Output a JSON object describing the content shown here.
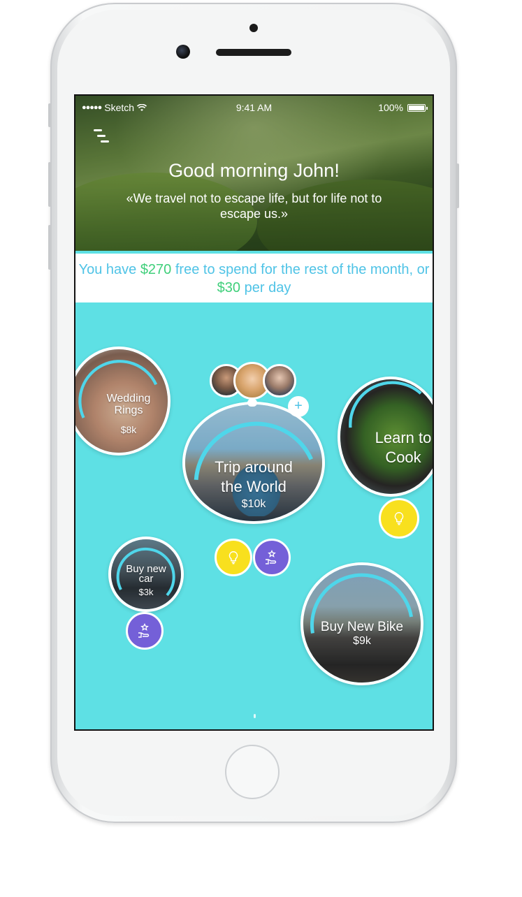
{
  "status_bar": {
    "carrier": "Sketch",
    "time": "9:41 AM",
    "battery": "100%"
  },
  "header": {
    "menu_icon": "menu-icon",
    "greeting": "Good morning John!",
    "quote": "«We travel not to escape life, but for life not to escape us.»"
  },
  "summary": {
    "prefix": "You have ",
    "free_amount": "$270",
    "middle": " free to spend for the rest of the month, or ",
    "daily_amount": "$30",
    "suffix": " per day"
  },
  "goals": [
    {
      "name": "Wedding Rings",
      "amount": "$8k"
    },
    {
      "name": "Trip around the World",
      "amount": "$10k"
    },
    {
      "name": "Learn to Cook",
      "amount": ""
    },
    {
      "name": "Buy new car",
      "amount": "$3k"
    },
    {
      "name": "Buy New Bike",
      "amount": "$9k"
    }
  ],
  "shared": {
    "add_label": "+"
  },
  "colors": {
    "background": "#5ee0e4",
    "accent": "#4fc3e6",
    "money": "#3fcf7a",
    "idea": "#f8e01e",
    "gift": "#7460d8"
  },
  "icons": {
    "idea": "lightbulb-icon",
    "gift": "hand-star-icon"
  }
}
